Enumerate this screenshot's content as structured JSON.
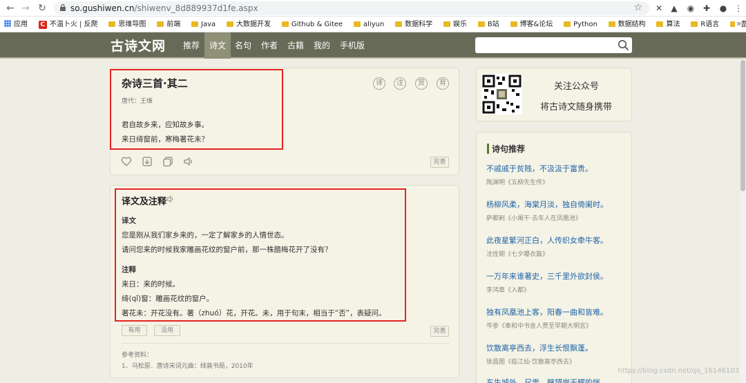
{
  "browser": {
    "url_host": "so.gushiwen.cn",
    "url_path": "/shiwenv_8d889937d1fe.aspx",
    "bookmarks": [
      "应用",
      "不温卜火 | 反爬",
      "思维导图",
      "前端",
      "Java",
      "大数据开发",
      "Github & Gitee",
      "aliyun",
      "数据科学",
      "娱乐",
      "B站",
      "博客&论坛",
      "Python",
      "数据结构",
      "算法",
      "R语言",
      "虚拟化"
    ],
    "more": "»"
  },
  "site": {
    "logo": "古诗文网",
    "nav": [
      "推荐",
      "诗文",
      "名句",
      "作者",
      "古籍",
      "我的",
      "手机版"
    ],
    "search_placeholder": ""
  },
  "poem": {
    "title": "杂诗三首·其二",
    "meta": "唐代：王维",
    "lines": [
      "君自故乡来，应知故乡事。",
      "来日绮窗前，寒梅著花未？"
    ],
    "round_icons": [
      "译",
      "注",
      "赏",
      "背"
    ],
    "complete_label": "完善"
  },
  "translation": {
    "title": "译文及注释",
    "trans_heading": "译文",
    "trans_lines": [
      "您是刚从我们家乡来的，一定了解家乡的人情世态。",
      "请问您来的时候我家雕画花纹的窗户前，那一株腊梅花开了没有？"
    ],
    "notes_heading": "注释",
    "note_lines": [
      "来日：来的时候。",
      "绮(qǐ)窗：雕画花纹的窗户。",
      "著花未：开花没有。著（zhuó）花，开花。未，用于句末，相当于“否”，表疑问。"
    ],
    "useful_label": "有用",
    "useless_label": "没用",
    "complete_label": "完善",
    "ref_heading": "参考资料：",
    "ref_line": "1、马松原．唐诗宋词元曲：线装书局，2010年"
  },
  "sidebar": {
    "follow_label": "关注公众号",
    "carry_label": "将古诗文随身携带",
    "recommend_heading": "诗句推荐",
    "quotes": [
      {
        "text": "不戚戚于贫贱，不汲汲于富贵。",
        "source": "陶渊明《五柳先生传》"
      },
      {
        "text": "杨柳风柔，海棠月淡，独自倚阑时。",
        "source": "萨都剌《小阑干·去年人在凤凰池》"
      },
      {
        "text": "此夜星繁河正白，人传织女牵牛客。",
        "source": "沈佺期《七夕曝衣篇》"
      },
      {
        "text": "一万年来谁著史，三千里外欲封侯。",
        "source": "李鸿章《入都》"
      },
      {
        "text": "独有凤凰池上客，阳春一曲和皆难。",
        "source": "岑参《奉和中书舍人贾至早朝大明宫》"
      },
      {
        "text": "饮散离亭西去，浮生长恨飘蓬。",
        "source": "徐昌图《临江仙·饮散离亭西去》"
      },
      {
        "text": "东生城外，尺雪，瞎望岸无耀的恍",
        "source": ""
      }
    ]
  },
  "watermark": "https://blog.csdn.net/qq_16146103"
}
